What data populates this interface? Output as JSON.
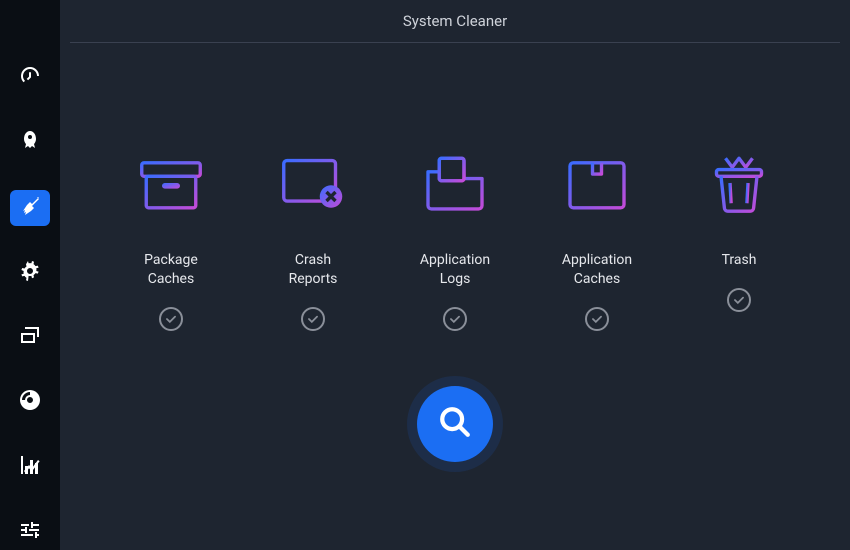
{
  "header": {
    "title": "System Cleaner"
  },
  "sidebar": {
    "items": [
      {
        "name": "dashboard",
        "icon": "gauge-icon",
        "active": false
      },
      {
        "name": "startup-apps",
        "icon": "rocket-icon",
        "active": false
      },
      {
        "name": "system-cleaner",
        "icon": "broom-icon",
        "active": true
      },
      {
        "name": "services",
        "icon": "gears-icon",
        "active": false
      },
      {
        "name": "processes",
        "icon": "window-stack-icon",
        "active": false
      },
      {
        "name": "uninstaller",
        "icon": "disc-icon",
        "active": false
      },
      {
        "name": "resources",
        "icon": "chart-icon",
        "active": false
      },
      {
        "name": "settings",
        "icon": "sliders-icon",
        "active": false
      }
    ]
  },
  "categories": [
    {
      "id": "package-caches",
      "label": "Package\nCaches",
      "icon": "box-archive-icon",
      "checked": true
    },
    {
      "id": "crash-reports",
      "label": "Crash\nReports",
      "icon": "crash-window-icon",
      "checked": true
    },
    {
      "id": "application-logs",
      "label": "Application\nLogs",
      "icon": "folder-doc-icon",
      "checked": true
    },
    {
      "id": "application-caches",
      "label": "Application\nCaches",
      "icon": "package-box-icon",
      "checked": true
    },
    {
      "id": "trash",
      "label": "Trash",
      "icon": "trash-icon",
      "checked": true
    }
  ],
  "actions": {
    "scan": "Scan"
  },
  "colors": {
    "accent": "#1b6ef3",
    "grad_a": "#3a6cff",
    "grad_b": "#c44bd8"
  }
}
